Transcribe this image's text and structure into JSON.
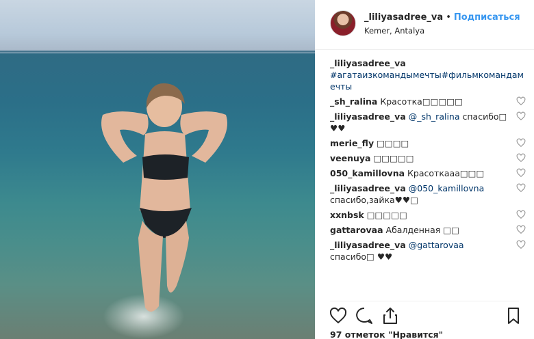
{
  "post": {
    "username": "_liliyasadree_va",
    "separator": "•",
    "follow_label": "Подписаться",
    "location": "Kemer, Antalya"
  },
  "caption": {
    "username": "_liliyasadree_va",
    "hashtags": "#агатаизкомандымечты#фильмкомандамечты"
  },
  "comments": [
    {
      "user": "_sh_ralina",
      "text": "Красотка□□□□□"
    },
    {
      "user": "_liliyasadree_va",
      "mention": "@_sh_ralina",
      "text": " спасибо□ ♥♥"
    },
    {
      "user": "merie_fly",
      "text": "□□□□"
    },
    {
      "user": "veenuya",
      "text": "□□□□□"
    },
    {
      "user": "050_kamillovna",
      "text": "Красоткааа□□□"
    },
    {
      "user": "_liliyasadree_va",
      "mention": "@050_kamillovna",
      "text": " спасибо,зайка♥♥□"
    },
    {
      "user": "xxnbsk",
      "text": "□□□□□"
    },
    {
      "user": "gattarovaa",
      "text": "Абалденная □□"
    },
    {
      "user": "_liliyasadree_va",
      "mention": "@gattarovaa",
      "text": " спасибо□ ♥♥"
    }
  ],
  "likes": {
    "text": "97 отметок \"Нравится\""
  },
  "icons": {
    "like": "heart-icon",
    "comment": "comment-icon",
    "share": "share-icon",
    "save": "bookmark-icon"
  },
  "colors": {
    "link_blue": "#3897f0",
    "hashtag": "#003569",
    "text": "#262626",
    "divider": "#efefef"
  }
}
